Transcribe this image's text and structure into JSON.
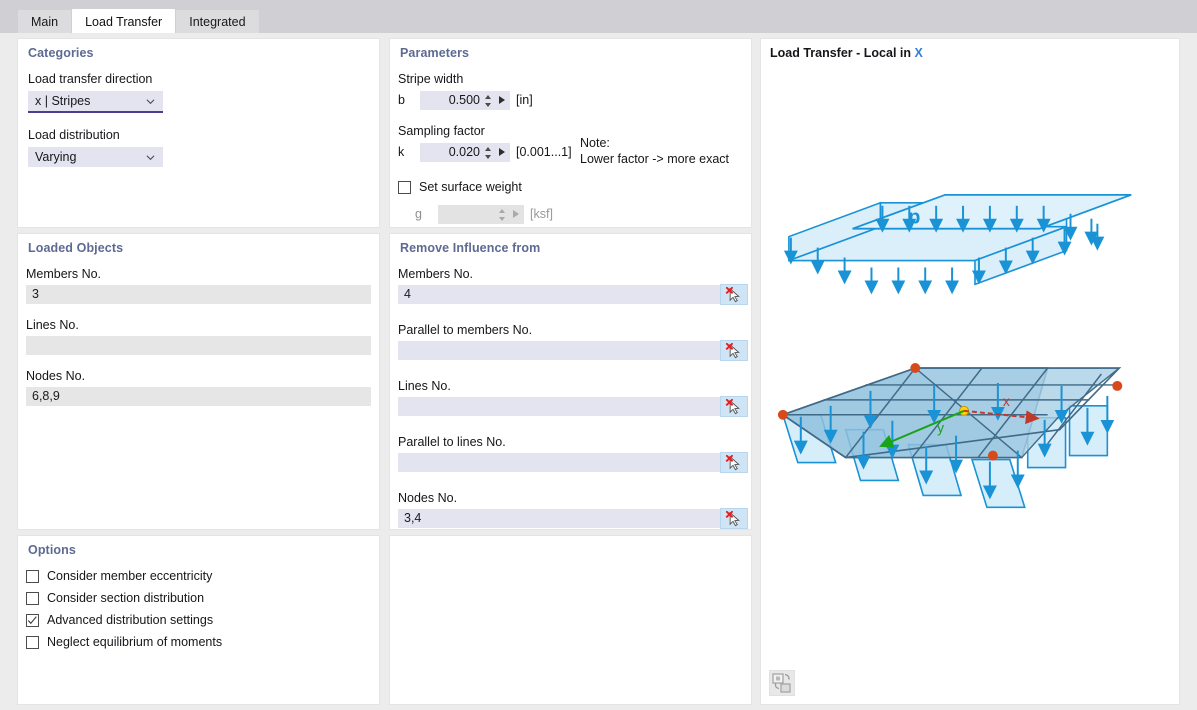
{
  "window": {
    "tabs": [
      {
        "label": "Main",
        "active": false
      },
      {
        "label": "Load Transfer",
        "active": true
      },
      {
        "label": "Integrated",
        "active": false
      }
    ]
  },
  "categories": {
    "title": "Categories",
    "direction_label": "Load transfer direction",
    "direction_value": "x | Stripes",
    "distribution_label": "Load distribution",
    "distribution_value": "Varying"
  },
  "parameters": {
    "title": "Parameters",
    "stripe_width_label": "Stripe width",
    "b_symbol": "b",
    "b_value": "0.500",
    "b_unit": "[in]",
    "sampling_factor_label": "Sampling factor",
    "k_symbol": "k",
    "k_value": "0.020",
    "k_range": "[0.001...1]",
    "note_line1": "Note:",
    "note_line2": "Lower factor -> more exact",
    "surface_weight_label": "Set surface weight",
    "surface_weight_checked": false,
    "g_symbol": "g",
    "g_value": "",
    "g_unit": "[ksf]"
  },
  "loaded_objects": {
    "title": "Loaded Objects",
    "fields": [
      {
        "label": "Members No.",
        "value": "3"
      },
      {
        "label": "Lines No.",
        "value": ""
      },
      {
        "label": "Nodes No.",
        "value": "6,8,9"
      }
    ]
  },
  "remove_influence": {
    "title": "Remove Influence from",
    "fields": [
      {
        "label": "Members No.",
        "value": "4",
        "pick_icon": "cursor-delete-icon"
      },
      {
        "label": "Parallel to members No.",
        "value": "",
        "pick_icon": "cursor-delete-icon"
      },
      {
        "label": "Lines No.",
        "value": "",
        "pick_icon": "cursor-delete-icon"
      },
      {
        "label": "Parallel to lines No.",
        "value": "",
        "pick_icon": "cursor-delete-icon"
      },
      {
        "label": "Nodes No.",
        "value": "3,4",
        "pick_icon": "cursor-delete-icon"
      }
    ]
  },
  "options": {
    "title": "Options",
    "items": [
      {
        "label": "Consider member eccentricity",
        "checked": false
      },
      {
        "label": "Consider section distribution",
        "checked": false
      },
      {
        "label": "Advanced distribution settings",
        "checked": true
      },
      {
        "label": "Neglect equilibrium of moments",
        "checked": false
      }
    ]
  },
  "preview": {
    "title_main": "Load Transfer - Local in ",
    "title_axis": "X",
    "load_label": "p",
    "axis_x_label": "x",
    "axis_y_label": "y",
    "view_button_icon": "flip-view-icon"
  },
  "colors": {
    "accent_heading": "#5d6a93",
    "field_editable": "#e4e4f0",
    "field_readonly": "#e6e6e6",
    "pick_button": "#cfe4f5",
    "diagram_blue": "#1a93d6",
    "diagram_fill": "#bfe5f7",
    "axis_x": "#c0392b",
    "axis_y": "#19a319",
    "node_red": "#d94a1a",
    "focus_underline": "#4b3f8f"
  }
}
